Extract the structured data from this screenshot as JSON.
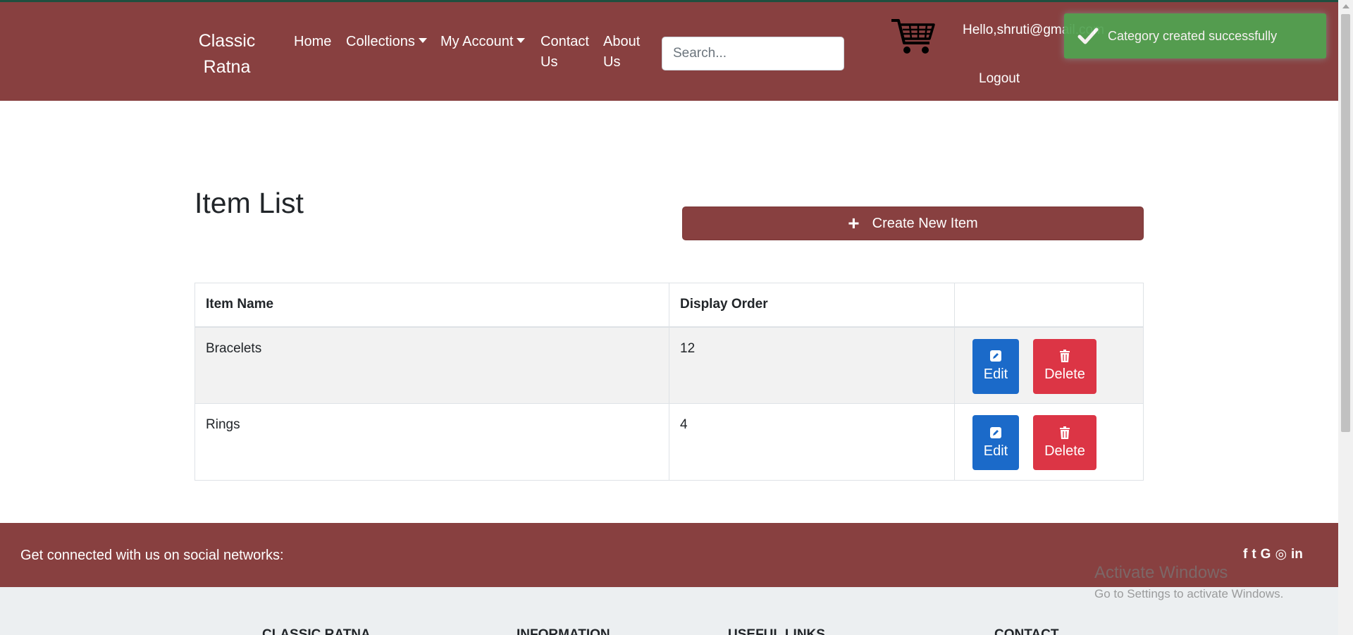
{
  "navbar": {
    "brand": "Classic Ratna",
    "links": [
      {
        "label": "Home"
      },
      {
        "label": "Collections"
      },
      {
        "label": "My Account"
      },
      {
        "label": "Contact Us"
      },
      {
        "label": "About Us"
      }
    ],
    "search_placeholder": "Search...",
    "greeting": "Hello,shruti@gmail.com",
    "logout": "Logout"
  },
  "toast": {
    "message": "Category created successfully",
    "color": "#51a351"
  },
  "main": {
    "title": "Item List",
    "create_button": "Create New Item",
    "table": {
      "headers": [
        "Item Name",
        "Display Order",
        ""
      ],
      "rows": [
        {
          "name": "Bracelets",
          "order": "12"
        },
        {
          "name": "Rings",
          "order": "4"
        }
      ],
      "edit_label": "Edit",
      "delete_label": "Delete"
    }
  },
  "social": {
    "text": "Get connected with us on social networks:",
    "icons": [
      "facebook-icon",
      "twitter-icon",
      "google-icon",
      "instagram-icon",
      "linkedin-icon"
    ],
    "glyphs": [
      "f",
      "t",
      "G",
      "◎",
      "in"
    ]
  },
  "footer": {
    "headings": [
      "Classic Ratna",
      "Information",
      "Useful Links",
      "Contact"
    ]
  },
  "watermark": {
    "line1": "Activate Windows",
    "line2": "Go to Settings to activate Windows."
  },
  "colors": {
    "brand": "#884040",
    "edit": "#1b6ac9",
    "delete": "#dc3545"
  }
}
